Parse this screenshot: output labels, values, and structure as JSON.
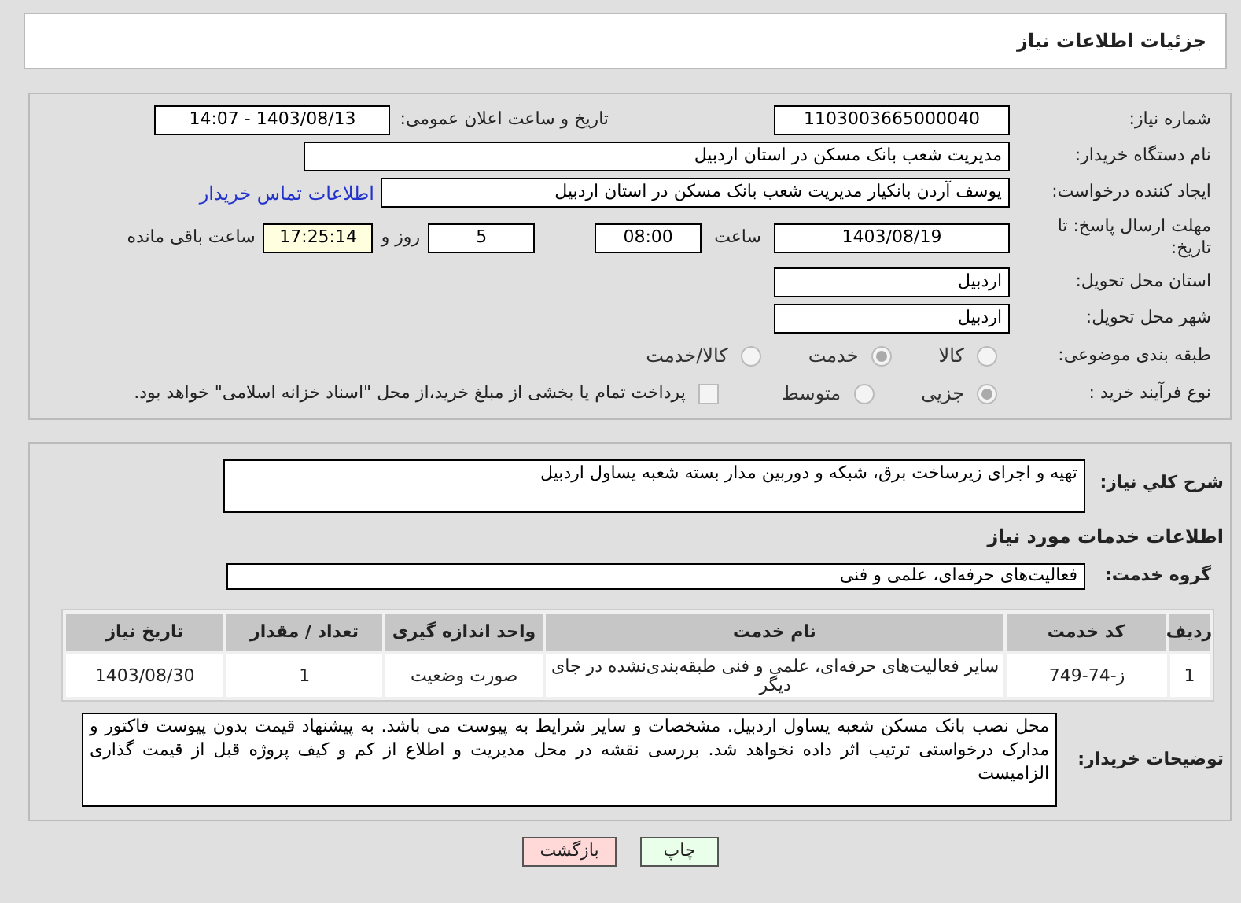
{
  "header": {
    "title": "جزئیات اطلاعات نیاز"
  },
  "form": {
    "need_number": {
      "label": "شماره نیاز:",
      "value": "1103003665000040"
    },
    "announce": {
      "label": "تاریخ و ساعت اعلان عمومی:",
      "value": "1403/08/13 - 14:07"
    },
    "buyer": {
      "label": "نام دستگاه خریدار:",
      "value": "مدیریت شعب بانک مسکن در استان اردبیل"
    },
    "creator": {
      "label": "ایجاد کننده درخواست:",
      "value": "یوسف  آردن بانکیار مدیریت شعب بانک مسکن در استان اردبیل",
      "link": "اطلاعات تماس خریدار"
    },
    "deadline": {
      "label": "مهلت ارسال پاسخ: تا تاریخ:",
      "date": "1403/08/19",
      "time_label": "ساعت",
      "time": "08:00",
      "days": "5",
      "days_label": "روز و",
      "remaining": "17:25:14",
      "remaining_label": "ساعت باقی مانده"
    },
    "province": {
      "label": "استان محل تحویل:",
      "value": "اردبیل"
    },
    "city": {
      "label": "شهر محل تحویل:",
      "value": "اردبیل"
    },
    "category": {
      "label": "طبقه بندی موضوعی:",
      "options": [
        {
          "label": "کالا",
          "selected": false
        },
        {
          "label": "خدمت",
          "selected": true
        },
        {
          "label": "کالا/خدمت",
          "selected": false
        }
      ]
    },
    "process": {
      "label": "نوع فرآیند خرید :",
      "options": [
        {
          "label": "جزیی",
          "selected": true
        },
        {
          "label": "متوسط",
          "selected": false
        }
      ],
      "payment": {
        "label": "پرداخت تمام یا بخشی از مبلغ خرید،از محل \"اسناد خزانه اسلامی\" خواهد بود.",
        "checked": false
      }
    }
  },
  "details": {
    "description": {
      "label": "شرح کلي نياز:",
      "value": "تهیه و اجرای زیرساخت برق، شبکه و دوربین مدار بسته شعبه یساول اردبیل"
    },
    "services_heading": "اطلاعات خدمات مورد نیاز",
    "group": {
      "label": "گروه خدمت:",
      "value": "فعالیت‌های حرفه‌ای، علمی و فنی"
    },
    "table": {
      "columns": [
        "ردیف",
        "کد خدمت",
        "نام خدمت",
        "واحد اندازه گیری",
        "تعداد / مقدار",
        "تاریخ نیاز"
      ],
      "rows": [
        [
          "1",
          "ز-74-749",
          "سایر فعالیت‌های حرفه‌ای، علمی و فنی طبقه‌بندی‌نشده در جای دیگر",
          "صورت وضعیت",
          "1",
          "1403/08/30"
        ]
      ]
    },
    "notes": {
      "label": "توضیحات خریدار:",
      "value": "محل نصب بانک مسکن شعبه یساول اردبیل. مشخصات و سایر شرایط به پیوست می باشد. به پیشنهاد قیمت بدون پیوست فاکتور و مدارک درخواستی ترتیب اثر داده نخواهد شد. بررسی نقشه در محل مدیریت و اطلاع از کم و کیف پروژه قبل از قیمت گذاری الزامیست"
    }
  },
  "buttons": [
    {
      "label": "چاپ",
      "kind": "print"
    },
    {
      "label": "بازگشت",
      "kind": "back"
    }
  ]
}
